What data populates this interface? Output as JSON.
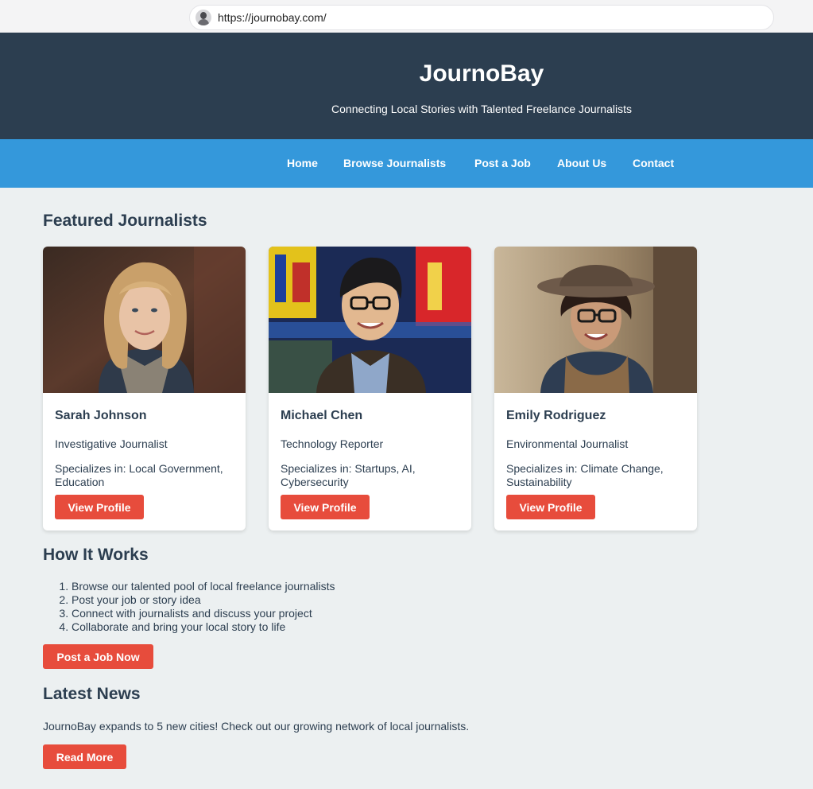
{
  "browser": {
    "url": "https://journobay.com/"
  },
  "header": {
    "title": "JournoBay",
    "tagline": "Connecting Local Stories with Talented Freelance Journalists"
  },
  "nav": {
    "items": [
      {
        "label": "Home"
      },
      {
        "label": "Browse Journalists"
      },
      {
        "label": "Post a Job"
      },
      {
        "label": "About Us"
      },
      {
        "label": "Contact"
      }
    ]
  },
  "featured": {
    "heading": "Featured Journalists",
    "journalists": [
      {
        "name": "Sarah Johnson",
        "role": "Investigative Journalist",
        "specialties": "Specializes in: Local Government, Education",
        "button": "View Profile"
      },
      {
        "name": "Michael Chen",
        "role": "Technology Reporter",
        "specialties": "Specializes in: Startups, AI, Cybersecurity",
        "button": "View Profile"
      },
      {
        "name": "Emily Rodriguez",
        "role": "Environmental Journalist",
        "specialties": "Specializes in: Climate Change, Sustainability",
        "button": "View Profile"
      }
    ]
  },
  "how_it_works": {
    "heading": "How It Works",
    "steps": [
      "Browse our talented pool of local freelance journalists",
      "Post your job or story idea",
      "Connect with journalists and discuss your project",
      "Collaborate and bring your local story to life"
    ],
    "button": "Post a Job Now"
  },
  "news": {
    "heading": "Latest News",
    "text": "JournoBay expands to 5 new cities! Check out our growing network of local journalists.",
    "button": "Read More"
  }
}
